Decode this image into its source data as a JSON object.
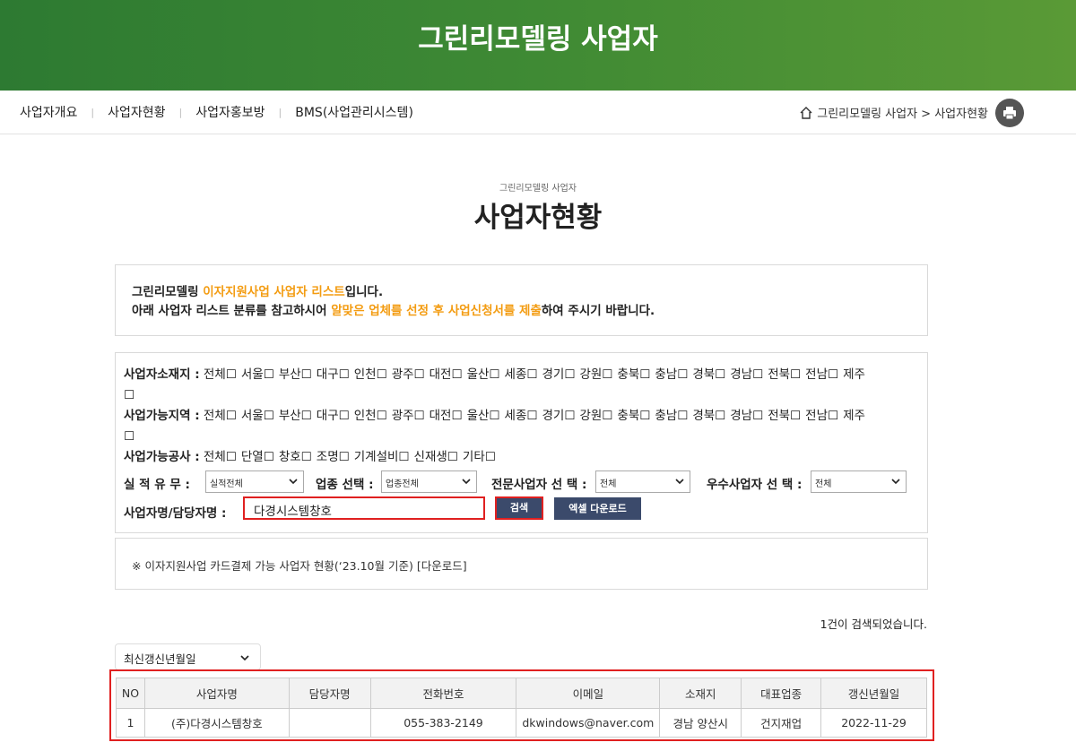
{
  "banner": {
    "title": "그린리모델링 사업자"
  },
  "nav": {
    "items": [
      "사업자개요",
      "사업자현황",
      "사업자홍보방",
      "BMS(사업관리시스템)"
    ],
    "separator": "|",
    "breadcrumb": "그린리모델링 사업자 > 사업자현황"
  },
  "heading": {
    "subtitle": "그린리모델링 사업자",
    "title": "사업자현황"
  },
  "notice": {
    "l1_a": "그린리모델링 ",
    "l1_b": "이자지원사업 사업자 리스트",
    "l1_c": "입니다.",
    "l2_a": "아래 사업자 리스트 분류를 참고하시어 ",
    "l2_b": "알맞은 업체를 선정 후 사업신청서를 제출",
    "l2_c": "하여 주시기 바랍니다."
  },
  "filters": {
    "location_label": "사업자소재지 :",
    "location_options": [
      "전체☐",
      "서울☐",
      "부산☐",
      "대구☐",
      "인천☐",
      "광주☐",
      "대전☐",
      "울산☐",
      "세종☐",
      "경기☐",
      "강원☐",
      "충북☐",
      "충남☐",
      "경북☐",
      "경남☐",
      "전북☐",
      "전남☐",
      "제주",
      "☐"
    ],
    "region_label": "사업가능지역 :",
    "region_options": [
      "전체☐",
      "서울☐",
      "부산☐",
      "대구☐",
      "인천☐",
      "광주☐",
      "대전☐",
      "울산☐",
      "세종☐",
      "경기☐",
      "강원☐",
      "충북☐",
      "충남☐",
      "경북☐",
      "경남☐",
      "전북☐",
      "전남☐",
      "제주",
      "☐"
    ],
    "work_label": "사업가능공사 :",
    "work_options": [
      "전체☐",
      "단열☐",
      "창호☐",
      "조명☐",
      "기계설비☐",
      "신재생☐",
      "기타☐"
    ],
    "perf_label": "실 적 유 무 :",
    "perf_value": "실적전체",
    "type_label": "업종 선택 :",
    "type_value": "업종전체",
    "expert_label": "전문사업자 선 택 :",
    "expert_value": "전체",
    "excellent_label": "우수사업자 선 택 :",
    "excellent_value": "전체",
    "name_label": "사업자명/담당자명 :",
    "name_value": "다경시스템창호",
    "search_btn": "검색",
    "excel_btn": "엑셀 다운로드"
  },
  "card_notice": {
    "text": "※ 이자지원사업 카드결제 가능 사업자 현황(‘23.10월 기준) ",
    "link": "[다운로드]"
  },
  "result": {
    "count_text": "1건이 검색되었습니다."
  },
  "sort": {
    "value": "최신갱신년월일"
  },
  "table": {
    "headers": [
      "NO",
      "사업자명",
      "담당자명",
      "전화번호",
      "이메일",
      "소재지",
      "대표업종",
      "갱신년월일"
    ],
    "rows": [
      [
        "1",
        "(주)다경시스템창호",
        "",
        "055-383-2149",
        "dkwindows@naver.com",
        "경남 양산시",
        "건지재업",
        "2022-11-29"
      ]
    ]
  },
  "colors": {
    "banner": "#2d7a32",
    "accent": "#f39c12",
    "button": "#3b4a6b",
    "highlight": "#e02020"
  }
}
